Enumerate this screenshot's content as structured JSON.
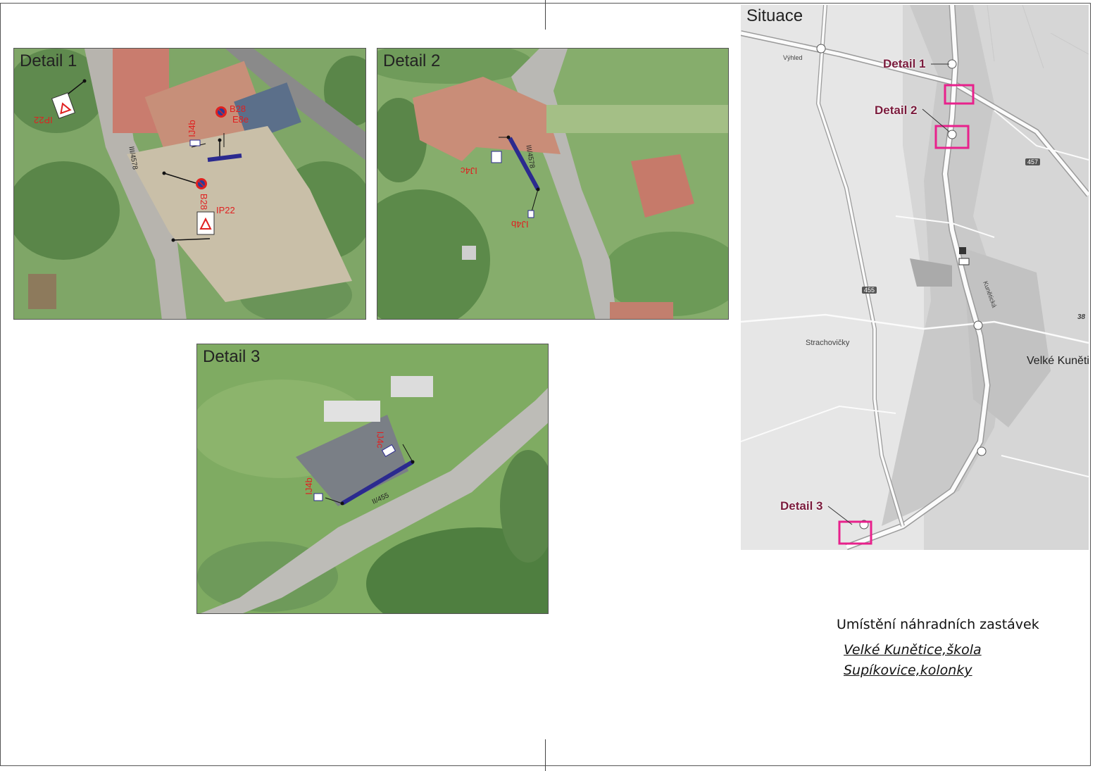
{
  "panels": {
    "detail1": {
      "title": "Detail 1",
      "road": "III/4578",
      "labels": [
        "IP22",
        "IJ4b",
        "B28",
        "E8e",
        "B28",
        "IP22"
      ]
    },
    "detail2": {
      "title": "Detail 2",
      "road": "III/4578",
      "labels": [
        "IJ4c",
        "IJ4b"
      ]
    },
    "detail3": {
      "title": "Detail 3",
      "road": "II/455",
      "labels": [
        "IJ4c",
        "IJ4b"
      ]
    }
  },
  "map": {
    "title": "Situace",
    "places": [
      "Výhled",
      "Strachovičky",
      "Velké Kunětice",
      "Kunětická"
    ],
    "route_numbers": [
      "457",
      "455"
    ],
    "markers": [
      "Detail 1",
      "Detail 2",
      "Detail 3"
    ],
    "edge_number": "38"
  },
  "caption": {
    "title": "Umístění náhradních zastávek",
    "stops": [
      "Velké Kunětice,škola",
      "Supíkovice,kolonky"
    ]
  },
  "colors": {
    "magenta": "#e8218c",
    "busstop_bar": "#2b2a8f",
    "sign_red": "#e02020"
  },
  "icons": [
    "bus-stop-icon",
    "warning-triangle-sign-icon",
    "no-stopping-sign-icon",
    "bus-stop-sign-icon",
    "post-office-icon",
    "church-icon"
  ]
}
